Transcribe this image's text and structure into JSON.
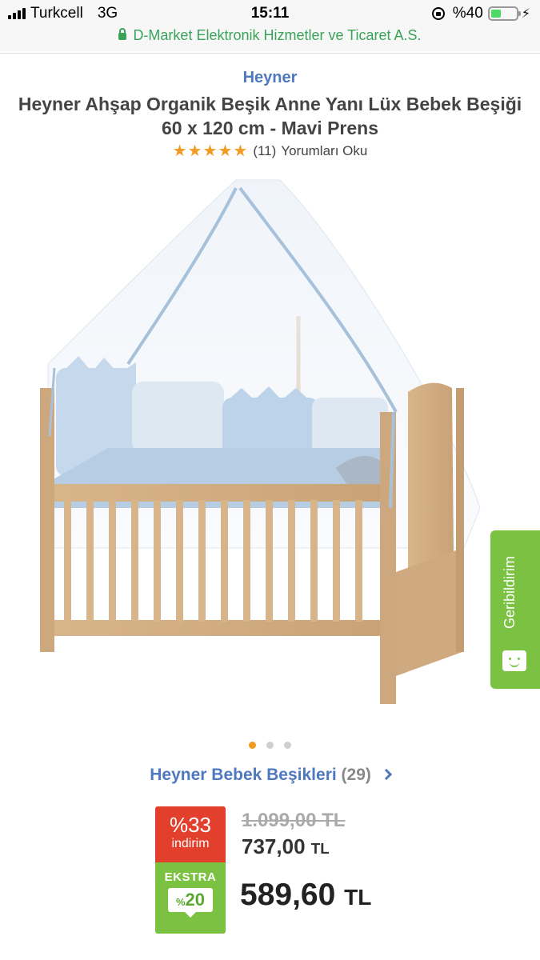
{
  "status_bar": {
    "carrier": "Turkcell",
    "network": "3G",
    "time": "15:11",
    "battery_text": "%40",
    "battery_level": 0.4
  },
  "url_bar": {
    "site_text": "D-Market Elektronik Hizmetler ve Ticaret A.S."
  },
  "product": {
    "brand": "Heyner",
    "title": "Heyner Ahşap Organik Beşik Anne Yanı Lüx Bebek Beşiği 60 x 120 cm - Mavi Prens",
    "stars": "★★★★★",
    "rating_value": 5,
    "review_count": "(11)",
    "review_link": "Yorumları Oku"
  },
  "gallery": {
    "image_count": 3,
    "active_index": 0
  },
  "feedback": {
    "label": "Geribildirim"
  },
  "category": {
    "label": "Heyner Bebek Beşikleri",
    "count": "(29)"
  },
  "price": {
    "discount_pct": "%33",
    "discount_label": "indirim",
    "extra_label": "EKSTRA",
    "extra_pct_sign": "%",
    "extra_pct": "20",
    "old_price": "1.099,00 TL",
    "sale_price": "737,00",
    "final_price": "589,60",
    "currency": "TL"
  },
  "colors": {
    "brand_blue": "#4e79c0",
    "discount_red": "#e2402d",
    "extra_green": "#7cc242",
    "star_orange": "#f39a23"
  }
}
